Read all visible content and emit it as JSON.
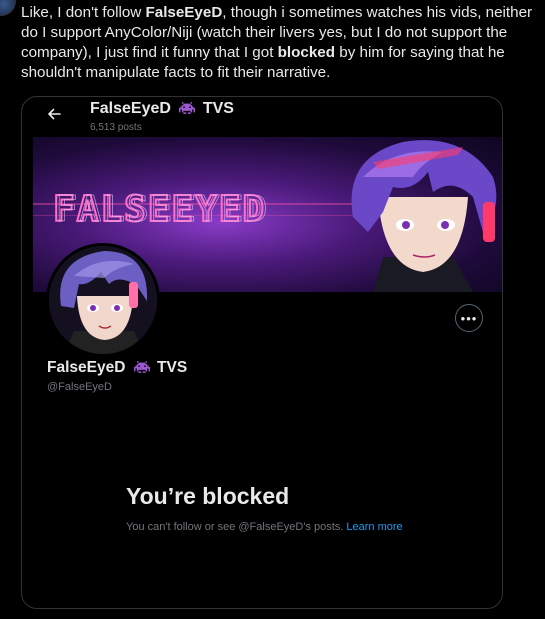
{
  "post": {
    "text_1": "Like, I don't follow ",
    "name_bold": "FalseEyeD",
    "text_2": ", though i sometimes watches his vids, neither do I support AnyColor/Niji (watch their livers yes, but I do not support the company), I just find it funny that I got ",
    "blocked_bold": "blocked",
    "text_3": " by him for saying that he shouldn't manipulate facts to fit their narrative."
  },
  "profile": {
    "display_name": "FalseEyeD",
    "name_suffix": "TVS",
    "post_count": "6,513 posts",
    "handle": "@FalseEyeD",
    "banner_logo_text": "FALSEEYED"
  },
  "blocked": {
    "title": "You’re blocked",
    "message": "You can't follow or see @FalseEyeD's posts. ",
    "learn_more": "Learn more"
  },
  "icons": {
    "back": "back-arrow-icon",
    "more": "more-horizontal-icon",
    "emoji": "alien-invader-icon"
  },
  "colors": {
    "accent": "#1d9bf0",
    "secondary_text": "#71767b",
    "border": "#2f3336",
    "emoji_purple": "#9b59d0"
  }
}
